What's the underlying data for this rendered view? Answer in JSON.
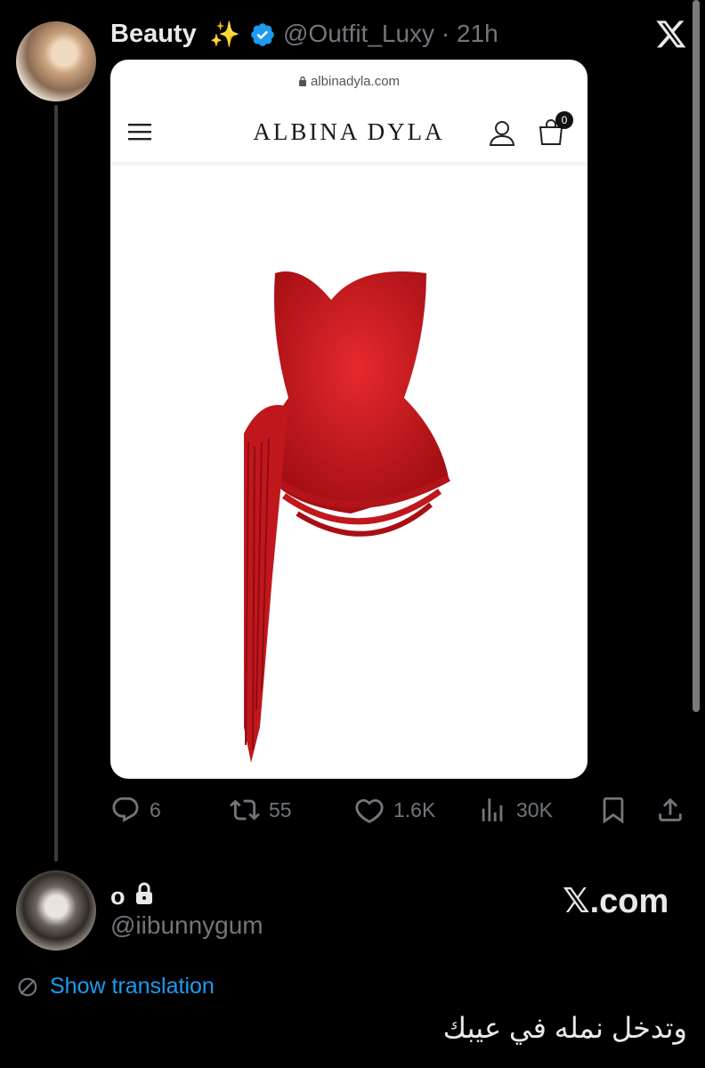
{
  "tweet": {
    "author_name": "Beauty",
    "author_emoji": "✨",
    "handle_time": "@Outfit_Luxy · 21h",
    "close_icon": "x-logo-icon",
    "image": {
      "url_text": "albinadyla.com",
      "brand": "ALBINA DYLA",
      "cart_count": "0",
      "icons": [
        "hamburger-menu-icon",
        "user-icon",
        "shopping-bag-icon"
      ]
    },
    "actions": {
      "replies": "6",
      "retweets": "55",
      "likes": "1.6K",
      "views": "30K"
    }
  },
  "reply": {
    "name": "o",
    "handle": "@iibunnygum",
    "watermark": "𝕏.com",
    "show_translation": "Show translation",
    "text": "وتدخل نمله في عيبك"
  },
  "colors": {
    "background": "#000000",
    "text": "#e7e9ea",
    "muted": "#71767b",
    "link": "#1d9bf0",
    "verified": "#1d9bf0",
    "dress": "#c4161c"
  }
}
